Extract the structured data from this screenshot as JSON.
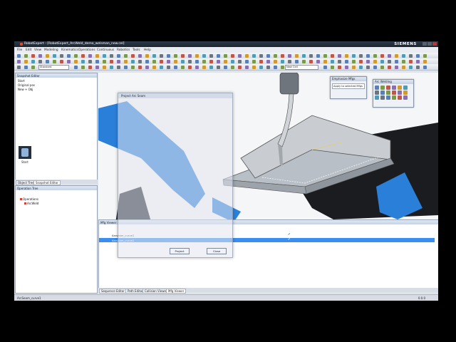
{
  "window": {
    "title": "RobotExpert - [RobotExpert_ArcWeld_demo_welsman_new.cel]",
    "brand": "SIEMENS"
  },
  "menu": [
    "File",
    "Edit",
    "View",
    "Modeling",
    "Kinematics",
    "Operations",
    "Continuous",
    "Robotics",
    "Tools",
    "Help"
  ],
  "toolbar": {
    "layout_select": "Standard",
    "cell_select": "New Cell"
  },
  "snapshot_editor": {
    "title": "Snapshot Editor",
    "items": [
      "Start",
      "Original pos",
      "New + Obj"
    ],
    "thumb_label": "Start",
    "tabs": [
      "Object Tree",
      "Snapshot Editor"
    ]
  },
  "operation_tree": {
    "title": "Operation Tree",
    "items": [
      "Operations",
      "ArcWeld"
    ]
  },
  "emphasize_panel": {
    "title": "Emphasize Mfgs",
    "button": "Apply to selected Mfgs"
  },
  "arc_panel": {
    "title": "Arc Welding"
  },
  "mfg_viewer": {
    "title": "Mfg Viewer",
    "rows": [
      "Arcseam_curve1",
      "Arcseam_curve2"
    ]
  },
  "dialog": {
    "title": "Project Arc Seam",
    "buttons": [
      "Project",
      "Close"
    ]
  },
  "bottom_tabs": [
    "Sequence Editor",
    "Path Editor",
    "Collision Viewer",
    "Mfg Viewer"
  ],
  "status": {
    "left": "ArcSeam_curve1",
    "right": "0.0.0"
  },
  "colors": {
    "robot_blue": "#2a7fd9",
    "selection": "#3a8ef0",
    "siemens_title": "#1c2430"
  }
}
